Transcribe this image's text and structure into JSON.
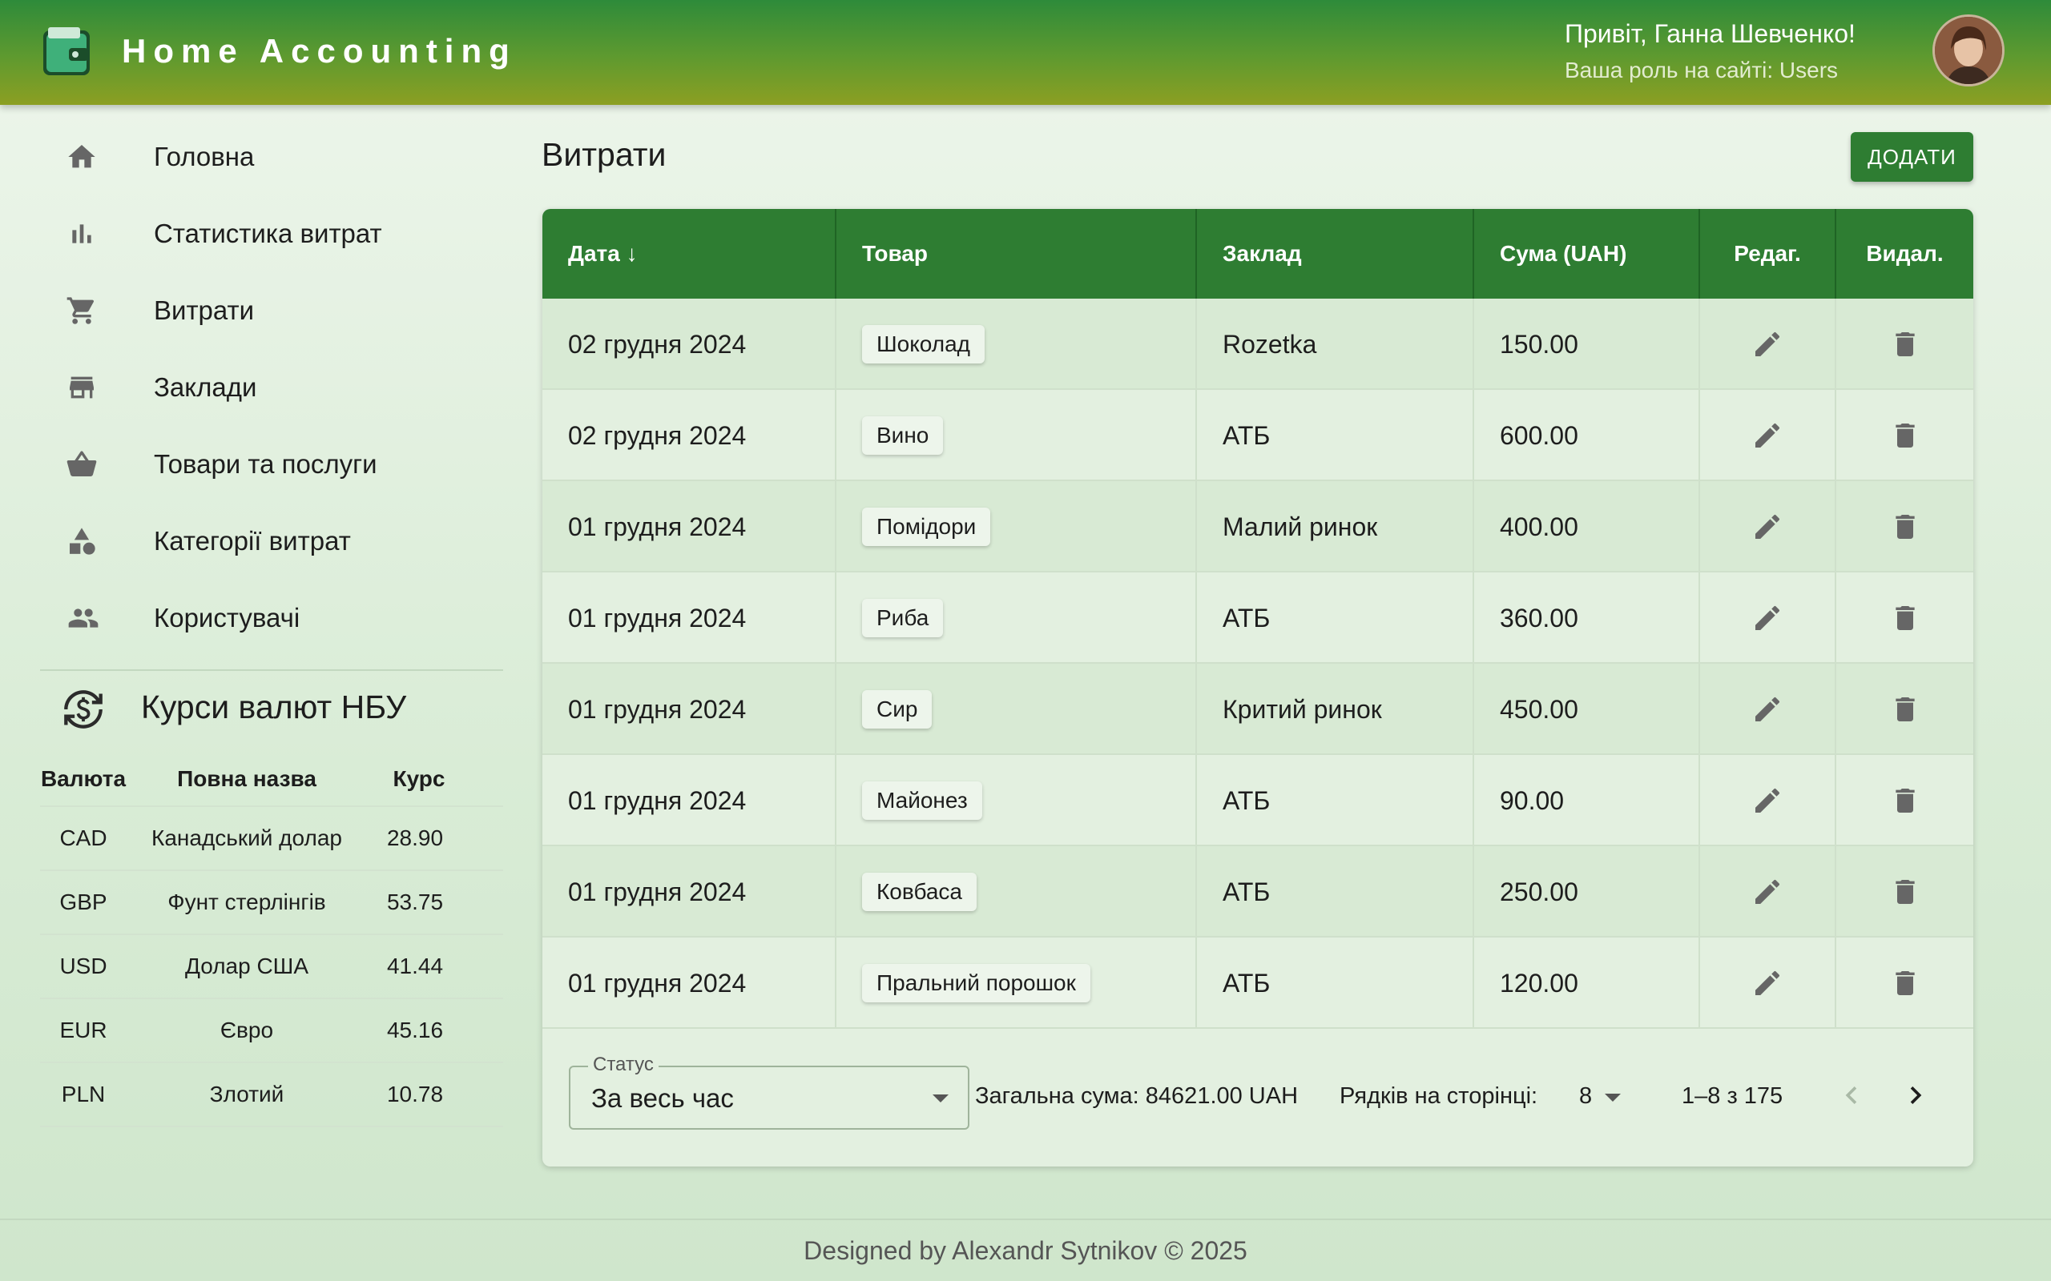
{
  "header": {
    "app_title": "Home Accounting",
    "greeting": "Привіт, Ганна Шевченко!",
    "role": "Ваша роль на сайті: Users"
  },
  "sidebar": {
    "items": [
      {
        "label": "Головна",
        "icon": "home-icon"
      },
      {
        "label": "Статистика витрат",
        "icon": "bar-chart-icon"
      },
      {
        "label": "Витрати",
        "icon": "cart-icon"
      },
      {
        "label": "Заклади",
        "icon": "store-icon"
      },
      {
        "label": "Товари та послуги",
        "icon": "basket-icon"
      },
      {
        "label": "Категорії витрат",
        "icon": "category-icon"
      },
      {
        "label": "Користувачі",
        "icon": "people-icon"
      }
    ],
    "rates": {
      "title": "Курси валют НБУ",
      "icon": "currency-exchange-icon",
      "headers": {
        "code": "Валюта",
        "name": "Повна назва",
        "rate": "Курс"
      },
      "rows": [
        {
          "code": "CAD",
          "name": "Канадський долар",
          "rate": "28.90"
        },
        {
          "code": "GBP",
          "name": "Фунт стерлінгів",
          "rate": "53.75"
        },
        {
          "code": "USD",
          "name": "Долар США",
          "rate": "41.44"
        },
        {
          "code": "EUR",
          "name": "Євро",
          "rate": "45.16"
        },
        {
          "code": "PLN",
          "name": "Злотий",
          "rate": "10.78"
        }
      ]
    }
  },
  "main": {
    "title": "Витрати",
    "add_label": "ДОДАТИ",
    "table": {
      "headers": {
        "date": "Дата ↓",
        "item": "Товар",
        "store": "Заклад",
        "sum": "Сума (UAH)",
        "edit": "Редаг.",
        "delete": "Видал."
      },
      "rows": [
        {
          "date": "02 грудня 2024",
          "item": "Шоколад",
          "store": "Rozetka",
          "sum": "150.00"
        },
        {
          "date": "02 грудня 2024",
          "item": "Вино",
          "store": "АТБ",
          "sum": "600.00"
        },
        {
          "date": "01 грудня 2024",
          "item": "Помідори",
          "store": "Малий ринок",
          "sum": "400.00"
        },
        {
          "date": "01 грудня 2024",
          "item": "Риба",
          "store": "АТБ",
          "sum": "360.00"
        },
        {
          "date": "01 грудня 2024",
          "item": "Сир",
          "store": "Критий ринок",
          "sum": "450.00"
        },
        {
          "date": "01 грудня 2024",
          "item": "Майонез",
          "store": "АТБ",
          "sum": "90.00"
        },
        {
          "date": "01 грудня 2024",
          "item": "Ковбаса",
          "store": "АТБ",
          "sum": "250.00"
        },
        {
          "date": "01 грудня 2024",
          "item": "Пральний порошок",
          "store": "АТБ",
          "sum": "120.00"
        }
      ]
    },
    "footer": {
      "status_label": "Статус",
      "status_value": "За весь час",
      "total": "Загальна сума: 84621.00 UAH",
      "rows_per_page_label": "Рядків на сторінці:",
      "rows_per_page_value": "8",
      "range": "1–8 з 175"
    }
  },
  "page_footer": "Designed by Alexandr Sytnikov © 2025",
  "colors": {
    "primary": "#2e7d32",
    "header_top": "#2e8b3a",
    "header_bottom": "#8c9f22",
    "background": "#e3f0e0"
  }
}
